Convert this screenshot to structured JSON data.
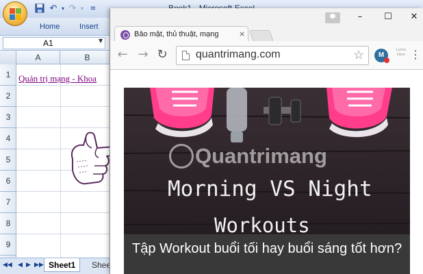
{
  "excel": {
    "window_title": "Book1 - Microsoft Excel",
    "ribbon_tabs": [
      "Home",
      "Insert"
    ],
    "name_box": "A1",
    "columns": [
      "A",
      "B"
    ],
    "rows": [
      "1",
      "2",
      "3",
      "4",
      "5",
      "6",
      "7",
      "8",
      "9"
    ],
    "cell_a1": "Quản trị mạng - Khoa",
    "sheet_tabs": [
      "Sheet1",
      "Shee"
    ],
    "quick_access": {
      "save_icon": "save-icon",
      "undo_icon": "undo-icon",
      "redo_icon": "redo-icon",
      "customize_icon": "customize-icon"
    }
  },
  "chrome": {
    "tab_title": "Bảo mật, thủ thuật, mạng",
    "tab_close": "×",
    "url": "quantrimang.com",
    "window_controls": {
      "minimize": "–",
      "maximize": "☐",
      "close": "✕"
    },
    "nav": {
      "back": "←",
      "forward": "→",
      "reload": "↻"
    },
    "star": "☆",
    "extensions": {
      "ext_m_label": "M",
      "lyrics_label": "Lyrics Here"
    },
    "menu": "⋮"
  },
  "article": {
    "image_line_1": "Morning VS Night",
    "image_line_2": "Workouts",
    "watermark": "Quantrimang",
    "caption": "Tập Workout buổi tối hay buổi sáng tốt hơn?"
  },
  "colors": {
    "excel_accent": "#15428b",
    "hyperlink_visited": "#800080",
    "shoe_pink": "#ff3d8a",
    "card_bg": "#2a2227"
  }
}
